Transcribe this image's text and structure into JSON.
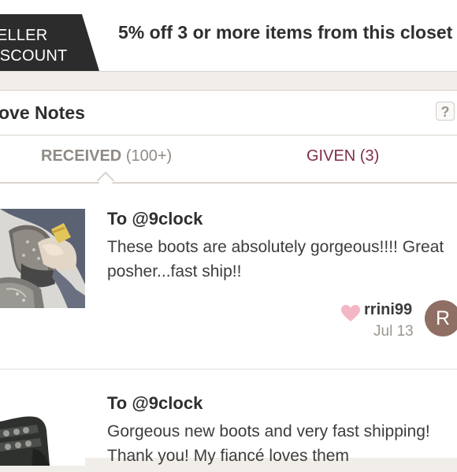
{
  "banner": {
    "tag_line1": "ELLER",
    "tag_line2": "ISCOUNT",
    "text": "5% off 3 or more items from this closet"
  },
  "love_notes": {
    "title": "ove Notes",
    "help_label": "?"
  },
  "tabs": {
    "received_label": "RECEIVED",
    "received_count": "(100+)",
    "given_label": "GIVEN (3)"
  },
  "notes": [
    {
      "recipient": "To @9clock",
      "text": "These boots are absolutely gorgeous!!!! Great posher...fast ship!!",
      "author": "rrini99",
      "date": "Jul 13",
      "avatar_letter": "R"
    },
    {
      "recipient": "To @9clock",
      "text": "Gorgeous new boots and very fast shipping! Thank you! My fiancé loves them"
    }
  ],
  "colors": {
    "accent": "#7f2c45",
    "heart": "#f4b7c4",
    "avatar": "#8f6f63"
  }
}
